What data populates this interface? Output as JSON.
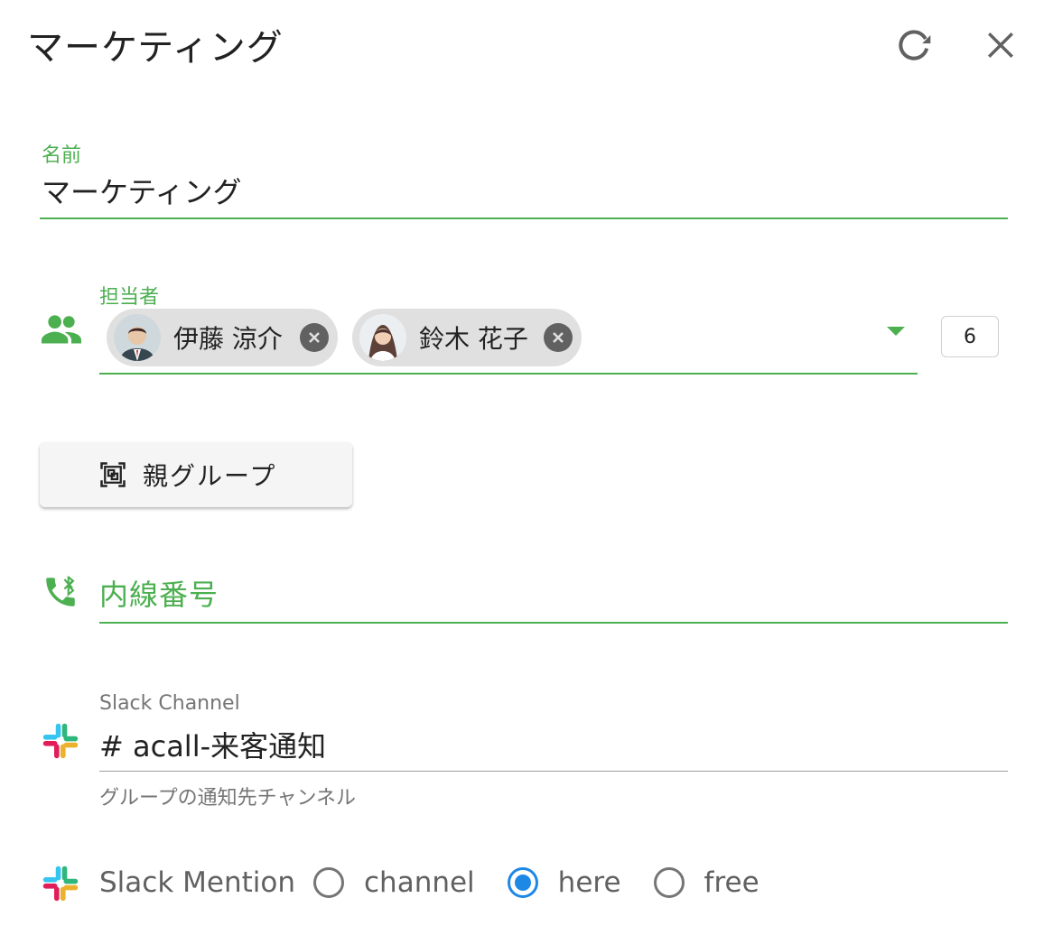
{
  "header": {
    "title": "マーケティング",
    "refresh_icon": "refresh-icon",
    "close_icon": "close-icon"
  },
  "name_field": {
    "label": "名前",
    "value": "マーケティング"
  },
  "assignee_field": {
    "label": "担当者",
    "icon": "people-icon",
    "chips": [
      {
        "name": "伊藤 涼介"
      },
      {
        "name": "鈴木 花子"
      }
    ],
    "count": "6"
  },
  "parent_group_button": {
    "label": "親グループ",
    "icon": "group-frame-icon"
  },
  "extension_field": {
    "label": "内線番号",
    "icon": "phone-bluetooth-icon"
  },
  "slack_channel": {
    "label": "Slack Channel",
    "value": "# acall-来客通知",
    "hint": "グループの通知先チャンネル"
  },
  "slack_mention": {
    "label": "Slack Mention",
    "options": [
      {
        "label": "channel"
      },
      {
        "label": "here"
      },
      {
        "label": "free"
      }
    ],
    "selected": "here"
  },
  "colors": {
    "accent": "#4caf50",
    "radio_selected": "#1e88e5",
    "chip_bg": "#e0e0e0"
  }
}
